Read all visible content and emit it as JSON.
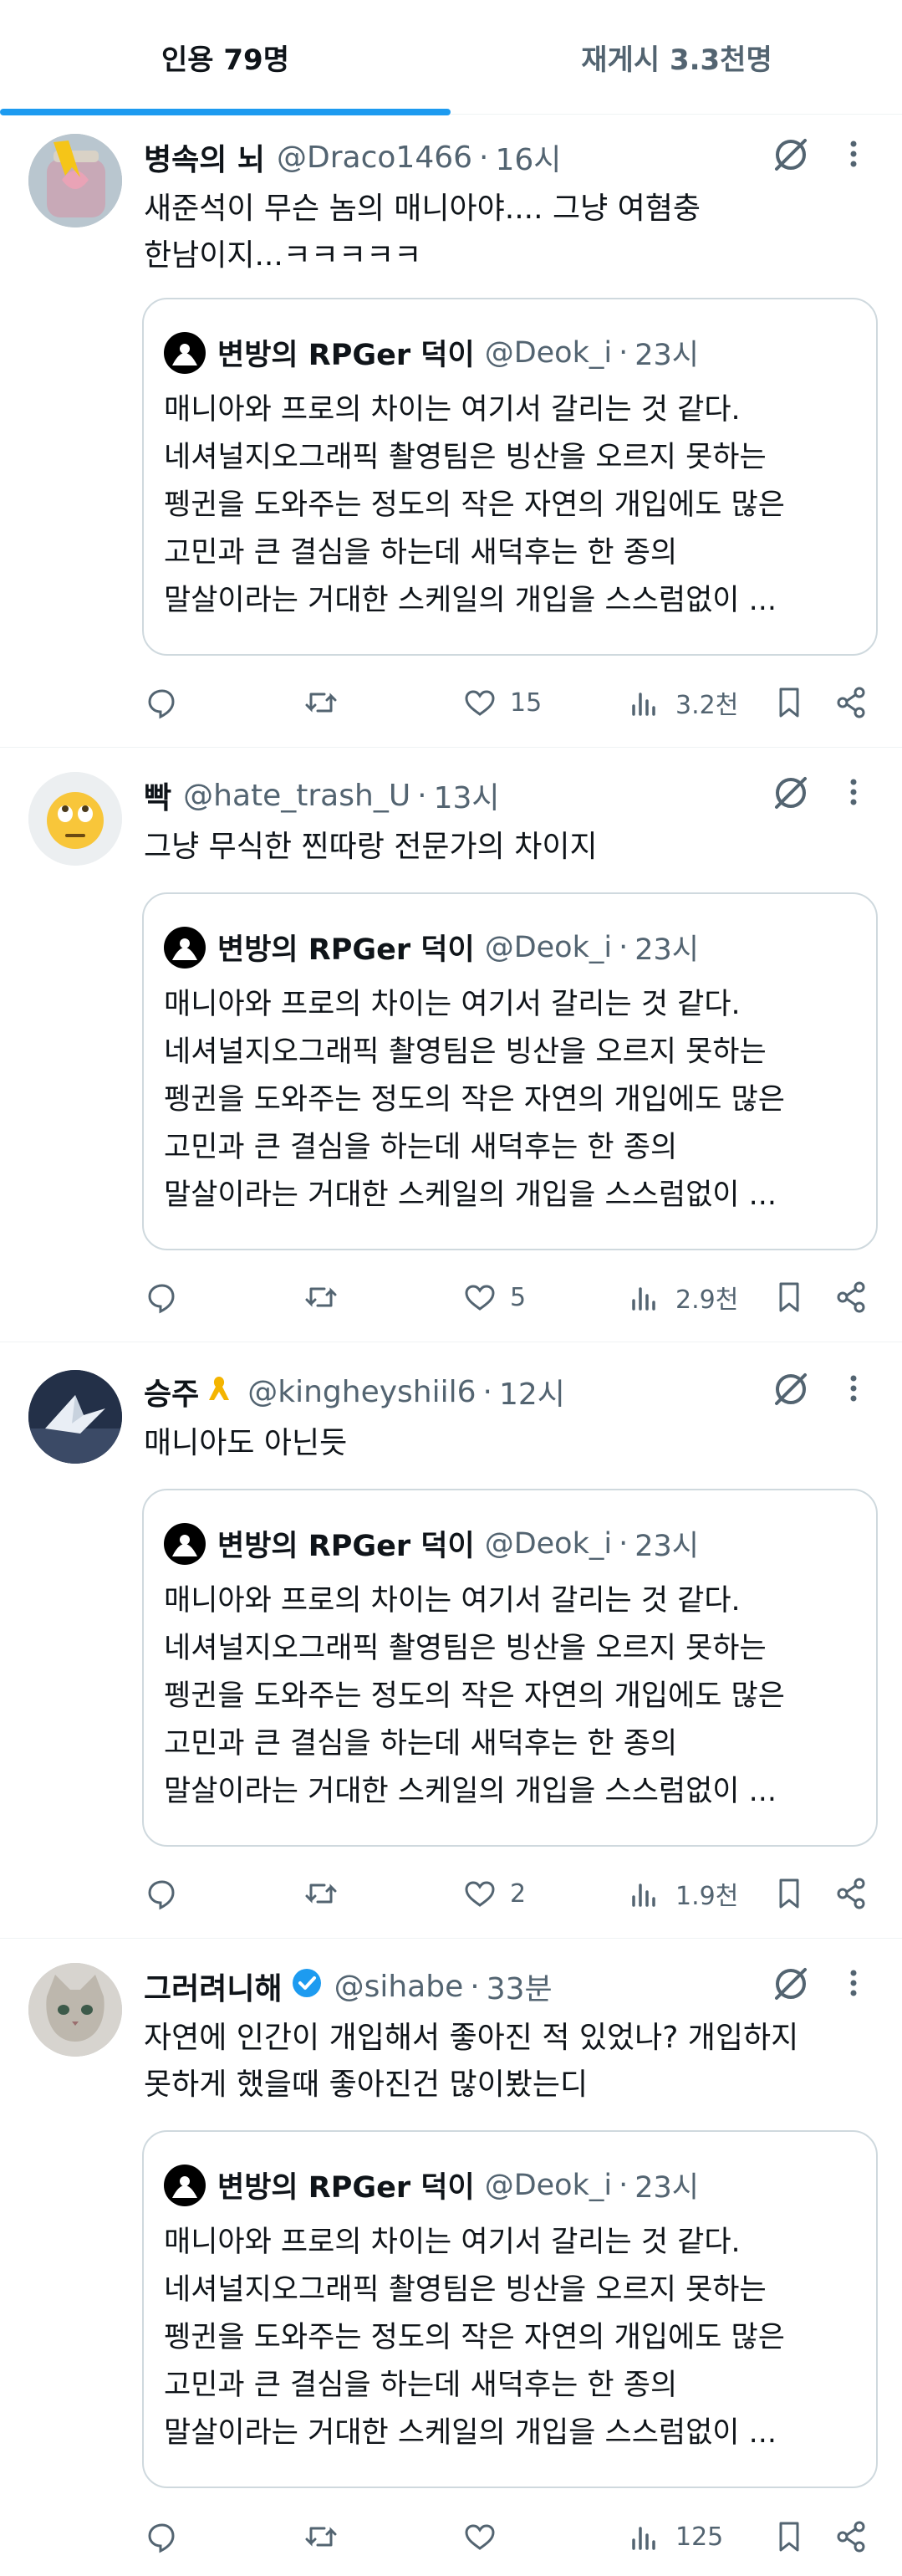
{
  "tabs": [
    {
      "label": "인용 79명"
    },
    {
      "label": "재게시 3.3천명"
    }
  ],
  "quoted": {
    "name": "변방의 RPGer 덕이",
    "handle": "@Deok_i",
    "time": "23시",
    "lines": [
      "매니아와 프로의 차이는 여기서 갈리는 것 같다.",
      "네셔널지오그래픽 촬영팀은 빙산을 오르지 못하는",
      "펭귄을 도와주는 정도의 작은 자연의 개입에도 많은",
      "고민과 큰 결심을 하는데 새덕후는 한 종의",
      "말살이라는 거대한 스케일의 개입을 스스럼없이 ..."
    ]
  },
  "posts": [
    {
      "name": "병속의 뇌",
      "handle": "@Draco1466",
      "time": "16시",
      "text_lines": [
        "새준석이 무슨 놈의 매니아야.... 그냥 여혐충",
        "한남이지...ㅋㅋㅋㅋㅋ"
      ],
      "likes": "15",
      "views": "3.2천",
      "avatar": "ribbon-jar-avatar"
    },
    {
      "name": "빡",
      "handle": "@hate_trash_U",
      "time": "13시",
      "text_lines": [
        "그냥 무식한 찐따랑 전문가의 차이지"
      ],
      "likes": "5",
      "views": "2.9천",
      "avatar": "eye-roll-emoji-avatar"
    },
    {
      "name": "승주",
      "handle": "@kingheyshiil6",
      "time": "12시",
      "text_lines": [
        "매니아도 아닌듯"
      ],
      "likes": "2",
      "views": "1.9천",
      "avatar": "paper-crane-avatar",
      "name_emoji": "🎗"
    },
    {
      "name": "그러려니해",
      "handle": "@sihabe",
      "time": "33분",
      "text_lines": [
        "자연에 인간이 개입해서 좋아진 적 있었나? 개입하지",
        "못하게 했을때 좋아진건 많이봤는디"
      ],
      "likes": "",
      "views": "125",
      "avatar": "cat-avatar",
      "verified": true
    }
  ],
  "colors": {
    "accent": "#1d9bf0",
    "text": "#0f1419",
    "muted": "#536471",
    "border": "#cfd9de"
  }
}
